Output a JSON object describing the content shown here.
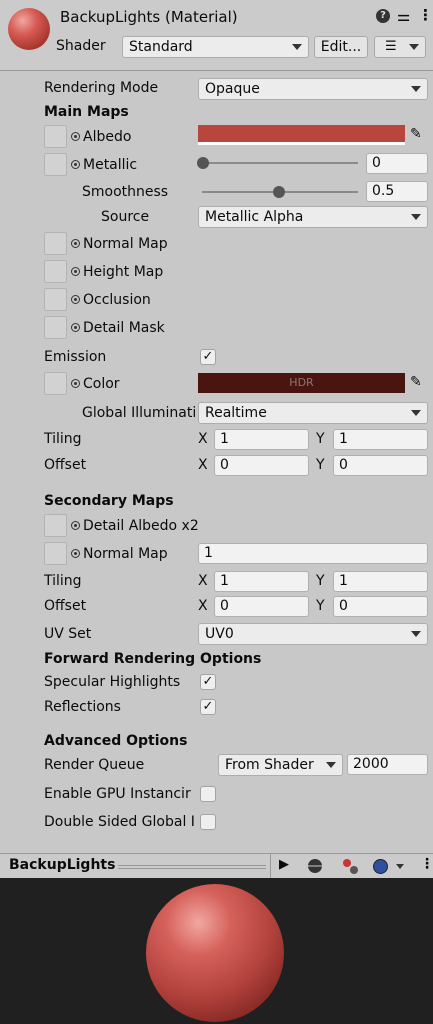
{
  "header": {
    "title": "BackupLights (Material)",
    "shader_label": "Shader",
    "shader_value": "Standard",
    "edit_label": "Edit..."
  },
  "rendering_mode": {
    "label": "Rendering Mode",
    "value": "Opaque"
  },
  "main_maps": {
    "heading": "Main Maps",
    "albedo_label": "Albedo",
    "albedo_color": "#b9463d",
    "metallic_label": "Metallic",
    "metallic_value": "0",
    "smoothness_label": "Smoothness",
    "smoothness_value": "0.5",
    "source_label": "Source",
    "source_value": "Metallic Alpha",
    "normal_map_label": "Normal Map",
    "height_map_label": "Height Map",
    "occlusion_label": "Occlusion",
    "detail_mask_label": "Detail Mask",
    "emission_label": "Emission",
    "emission_checked": "✓",
    "color_label": "Color",
    "color_swatch": "#4a1510",
    "hdr_label": "HDR",
    "gi_label": "Global Illuminati",
    "gi_value": "Realtime",
    "tiling_label": "Tiling",
    "tiling_x": "1",
    "tiling_y": "1",
    "offset_label": "Offset",
    "offset_x": "0",
    "offset_y": "0",
    "x_label": "X",
    "y_label": "Y"
  },
  "secondary_maps": {
    "heading": "Secondary Maps",
    "detail_albedo_label": "Detail Albedo x2",
    "normal_map_label": "Normal Map",
    "normal_map_value": "1",
    "tiling_label": "Tiling",
    "tiling_x": "1",
    "tiling_y": "1",
    "offset_label": "Offset",
    "offset_x": "0",
    "offset_y": "0",
    "uv_set_label": "UV Set",
    "uv_set_value": "UV0"
  },
  "forward_rendering": {
    "heading": "Forward Rendering Options",
    "specular_label": "Specular Highlights",
    "specular_checked": "✓",
    "reflections_label": "Reflections",
    "reflections_checked": "✓"
  },
  "advanced": {
    "heading": "Advanced Options",
    "render_queue_label": "Render Queue",
    "render_queue_mode": "From Shader",
    "render_queue_value": "2000",
    "gpu_instancing_label": "Enable GPU Instancir",
    "double_sided_label": "Double Sided Global I"
  },
  "preview": {
    "title": "BackupLights"
  },
  "colors": {
    "panel_bg": "#c8c8c8",
    "preview_bg": "#202020",
    "material_red": "#b9463d"
  }
}
